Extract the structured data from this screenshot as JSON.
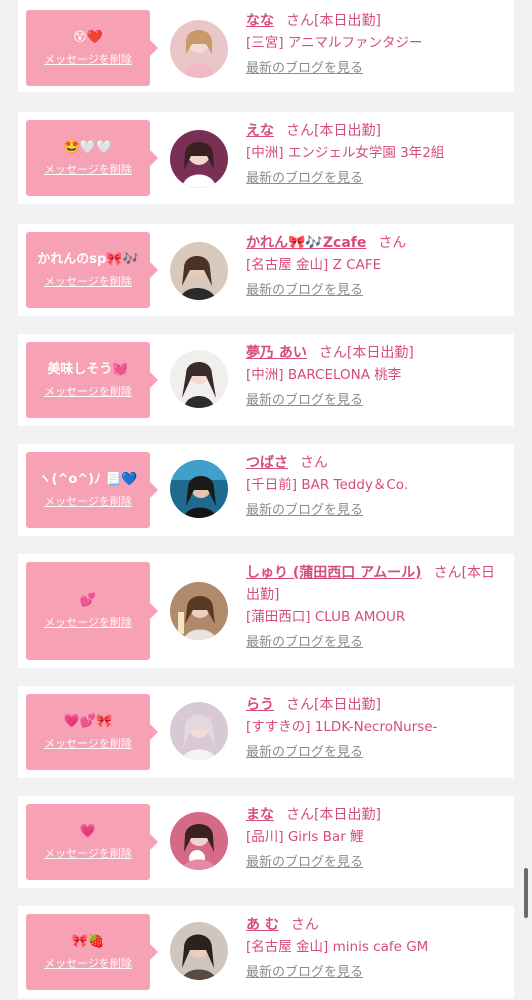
{
  "messages": [
    {
      "message": "😵❤️",
      "delete_label": "メッセージを削除",
      "name": "なな",
      "san": "さん",
      "status": "[本日出勤]",
      "shop": "[三宮] アニマルファンタジー",
      "blog": "最新のブログを見る",
      "avatar_color": "#e9c7c9"
    },
    {
      "message": "🤩🤍🤍",
      "delete_label": "メッセージを削除",
      "name": "えな",
      "san": "さん",
      "status": "[本日出勤]",
      "shop": "[中洲] エンジェル女学園 3年2組",
      "blog": "最新のブログを見る",
      "avatar_color": "#7a2f55"
    },
    {
      "message": "かれんのsp🎀🎶",
      "delete_label": "メッセージを削除",
      "name": "かれん🎀🎶Zcafe",
      "san": "さん",
      "status": "",
      "shop": "[名古屋 金山] Z CAFE",
      "blog": "最新のブログを見る",
      "avatar_color": "#d8c9bd"
    },
    {
      "message": "美味しそう💓",
      "delete_label": "メッセージを削除",
      "name": "夢乃 あい",
      "san": "さん",
      "status": "[本日出勤]",
      "shop": "[中洲] BARCELONA 桃李",
      "blog": "最新のブログを見る",
      "avatar_color": "#3a2b2b"
    },
    {
      "message": "ヽ(^o^)ﾉ 📃💙",
      "delete_label": "メッセージを削除",
      "name": "つばさ",
      "san": "さん",
      "status": "",
      "shop": "[千日前] BAR Teddy＆Co.",
      "blog": "最新のブログを見る",
      "avatar_color": "#1e6b8f"
    },
    {
      "message": "💕",
      "delete_label": "メッセージを削除",
      "name": "しゅり (蒲田西口 アムール)",
      "san": "さん",
      "status": "[本日出勤]",
      "shop": "[蒲田西口] CLUB AMOUR",
      "blog": "最新のブログを見る",
      "avatar_color": "#b08a6a"
    },
    {
      "message": "💗💕🎀",
      "delete_label": "メッセージを削除",
      "name": "らう",
      "san": "さん",
      "status": "[本日出勤]",
      "shop": "[すすきの] 1LDK-NecroNurse-",
      "blog": "最新のブログを見る",
      "avatar_color": "#d9c8d6"
    },
    {
      "message": "💗",
      "delete_label": "メッセージを削除",
      "name": "まな",
      "san": "さん",
      "status": "[本日出勤]",
      "shop": "[品川] Girls Bar 鯉",
      "blog": "最新のブログを見る",
      "avatar_color": "#d46a86"
    },
    {
      "message": "🎀🍓",
      "delete_label": "メッセージを削除",
      "name": "あ む",
      "san": "さん",
      "status": "",
      "shop": "[名古屋 金山] minis cafe GM",
      "blog": "最新のブログを見る",
      "avatar_color": "#5a4a44"
    }
  ],
  "colors": {
    "accent": "#d64d78",
    "bubble": "#f7a1b4",
    "background": "#f2f2f2"
  }
}
